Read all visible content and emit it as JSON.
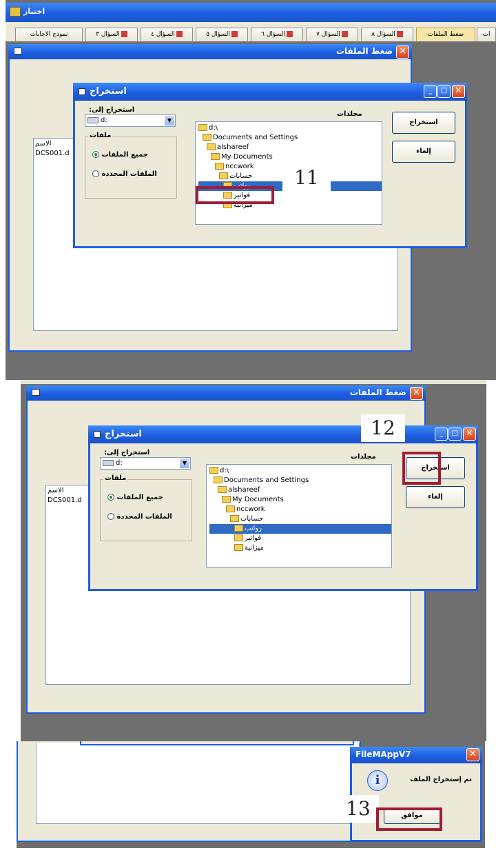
{
  "app": {
    "title": "اختبار"
  },
  "tabs": [
    {
      "label": "نموذج الاجابات"
    },
    {
      "label": "السؤال ٣",
      "marked": true
    },
    {
      "label": "السؤال ٤",
      "marked": true
    },
    {
      "label": "السؤال ٥",
      "marked": true
    },
    {
      "label": "السؤال ٦",
      "marked": true
    },
    {
      "label": "السؤال ٧",
      "marked": true
    },
    {
      "label": "السؤال ٨",
      "marked": true
    },
    {
      "label": "ضغط الملفات",
      "active": true
    },
    {
      "label": "ات"
    }
  ],
  "compress_window": {
    "title": "ضغط الملفات",
    "close": "✕"
  },
  "extract_dialog": {
    "title": "استخراج",
    "extract_to_label": "استخراج إلى:",
    "drive_value": "d:",
    "folders_label": "مجلدات",
    "files_group_label": "ملفات",
    "radio_all": "جميع الملفات",
    "radio_selected": "الملفات المحددة",
    "btn_extract": "استخراج",
    "btn_cancel": "إلغاء",
    "tree": [
      "d:\\",
      "Documents and Settings",
      "alshareef",
      "My Documents",
      "nccwork",
      "حسابات",
      "رواتب",
      "فواتير",
      "ميزانية"
    ],
    "selected_index": 6
  },
  "file_list": {
    "header": "الاسم",
    "file": "DCS001.d"
  },
  "callouts": {
    "step11": "11",
    "step12": "12",
    "step13": "13"
  },
  "message_box": {
    "title": "FileMAppV7",
    "text": "تم إستخراج الملف",
    "ok": "موافق",
    "close": "✕"
  }
}
